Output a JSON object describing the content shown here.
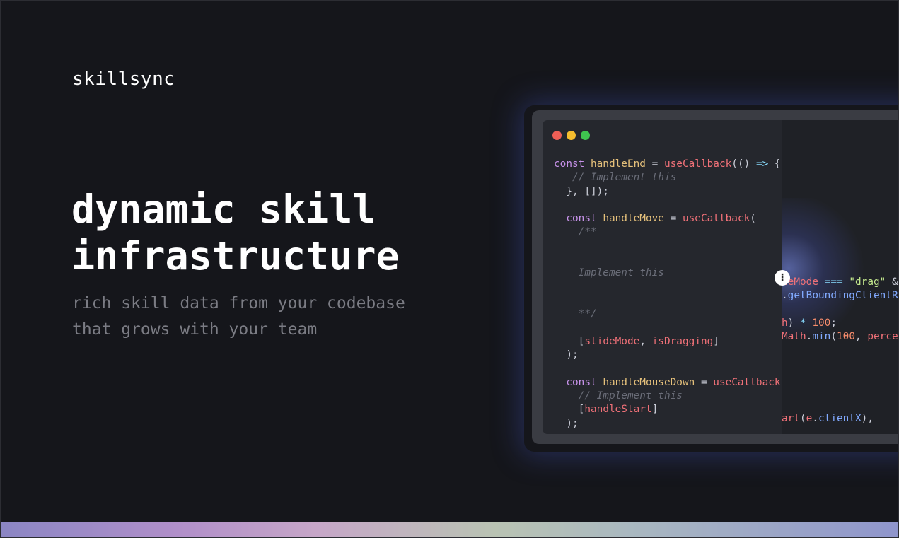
{
  "brand": {
    "name": "skillsync"
  },
  "hero": {
    "headline_lines": [
      "dynamic skill",
      "infrastructure"
    ],
    "subline_lines": [
      "rich skill data from your codebase",
      "that grows with your team"
    ]
  },
  "editor": {
    "left_code": [
      [
        [
          "kw",
          "const "
        ],
        [
          "fn",
          "handleEnd"
        ],
        [
          "pn",
          " = "
        ],
        [
          "call",
          "useCallback"
        ],
        [
          "pn",
          "(() "
        ],
        [
          "op",
          "=>"
        ],
        [
          "pn",
          " {"
        ]
      ],
      [
        [
          "cm",
          "   // Implement this"
        ]
      ],
      [
        [
          "pn",
          "  }, []);"
        ]
      ],
      [
        [
          "pn",
          ""
        ]
      ],
      [
        [
          "pn",
          "  "
        ],
        [
          "kw",
          "const "
        ],
        [
          "fn",
          "handleMove"
        ],
        [
          "pn",
          " = "
        ],
        [
          "call",
          "useCallback"
        ],
        [
          "pn",
          "("
        ]
      ],
      [
        [
          "cm",
          "    /**"
        ]
      ],
      [
        [
          "pn",
          ""
        ]
      ],
      [
        [
          "pn",
          ""
        ]
      ],
      [
        [
          "cm",
          "    Implement this"
        ]
      ],
      [
        [
          "pn",
          ""
        ]
      ],
      [
        [
          "pn",
          ""
        ]
      ],
      [
        [
          "cm",
          "    **/"
        ]
      ],
      [
        [
          "pn",
          ""
        ]
      ],
      [
        [
          "pn",
          "    ["
        ],
        [
          "var",
          "slideMode"
        ],
        [
          "pn",
          ", "
        ],
        [
          "var",
          "isDragging"
        ],
        [
          "pn",
          "]"
        ]
      ],
      [
        [
          "pn",
          "  );"
        ]
      ],
      [
        [
          "pn",
          ""
        ]
      ],
      [
        [
          "pn",
          "  "
        ],
        [
          "kw",
          "const "
        ],
        [
          "fn",
          "handleMouseDown"
        ],
        [
          "pn",
          " = "
        ],
        [
          "call",
          "useCallback"
        ]
      ],
      [
        [
          "cm",
          "    // Implement this"
        ]
      ],
      [
        [
          "pn",
          "    ["
        ],
        [
          "var",
          "handleStart"
        ],
        [
          "pn",
          "]"
        ]
      ],
      [
        [
          "pn",
          "  );"
        ]
      ]
    ],
    "right_code": [
      [
        [
          "var",
          "deMode"
        ],
        [
          "pn",
          " "
        ],
        [
          "op",
          "==="
        ],
        [
          "pn",
          " "
        ],
        [
          "str",
          "\"drag\""
        ],
        [
          "pn",
          " &"
        ]
      ],
      [
        [
          "pn",
          "."
        ],
        [
          "prop",
          "getBoundingClientRe"
        ]
      ],
      [
        [
          "pn",
          ""
        ]
      ],
      [
        [
          "var",
          "h"
        ],
        [
          "pn",
          ") "
        ],
        [
          "op",
          "*"
        ],
        [
          "pn",
          " "
        ],
        [
          "num",
          "100"
        ],
        [
          "pn",
          ";"
        ]
      ],
      [
        [
          "var",
          "Math"
        ],
        [
          "pn",
          "."
        ],
        [
          "prop",
          "min"
        ],
        [
          "pn",
          "("
        ],
        [
          "num",
          "100"
        ],
        [
          "pn",
          ", "
        ],
        [
          "var",
          "percen"
        ]
      ],
      [
        [
          "pn",
          ""
        ]
      ],
      [
        [
          "pn",
          ""
        ]
      ],
      [
        [
          "pn",
          ""
        ]
      ],
      [
        [
          "pn",
          ""
        ]
      ],
      [
        [
          "pn",
          ""
        ]
      ],
      [
        [
          "call",
          "art"
        ],
        [
          "pn",
          "("
        ],
        [
          "var",
          "e"
        ],
        [
          "pn",
          "."
        ],
        [
          "prop",
          "clientX"
        ],
        [
          "pn",
          "),"
        ]
      ]
    ]
  },
  "colors": {
    "background": "#15161b",
    "window_red": "#ee5f56",
    "window_yellow": "#f5bd2e",
    "window_green": "#3fc54f"
  },
  "icons": {
    "slider_handle": "vertical-dots-icon"
  }
}
